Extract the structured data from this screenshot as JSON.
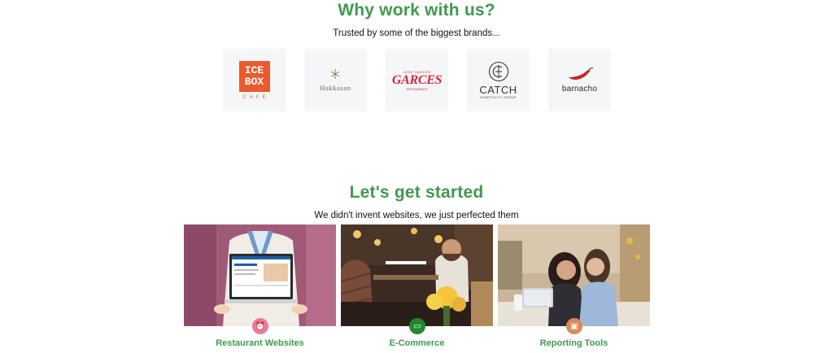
{
  "why": {
    "title": "Why work with us?",
    "subtitle": "Trusted by some of the biggest brands..."
  },
  "logos": [
    {
      "name": "ICE BOX CAFE",
      "line1": "ICE",
      "line2": "BOX",
      "line3": "CAFE",
      "color": "#e95a2c"
    },
    {
      "name": "Hakkasan",
      "word": "Hakkasan",
      "color": "#8a7a55"
    },
    {
      "name": "Garces",
      "top": "JOSE GARCES",
      "word": "GARCES",
      "bottom": "RESTAURANTS",
      "color": "#d7263d"
    },
    {
      "name": "Catch Hospitality Group",
      "word": "CATCH",
      "tag": "HOSPITALITY GROUP",
      "color": "#333333"
    },
    {
      "name": "barnacho",
      "word": "barnacho",
      "color": "#c6262e"
    }
  ],
  "start": {
    "title": "Let's get started",
    "subtitle": "We didn't invent websites, we just perfected them"
  },
  "cards": [
    {
      "label": "Restaurant Websites",
      "badge_color": "#e87a9d",
      "icon": "alarm-clock-icon"
    },
    {
      "label": "E-Commerce",
      "badge_color": "#1f8a2a",
      "icon": "card-icon"
    },
    {
      "label": "Reporting Tools",
      "badge_color": "#d98a55",
      "icon": "devices-icon"
    }
  ],
  "colors": {
    "accent": "#3f9a4f"
  }
}
